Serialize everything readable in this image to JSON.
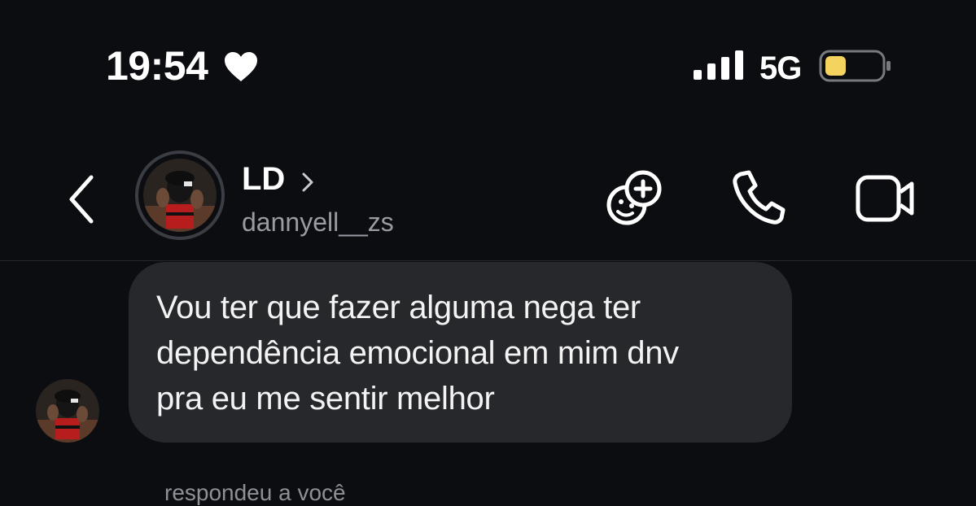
{
  "status_bar": {
    "time": "19:54",
    "network": "5G",
    "heart_icon": "heart-icon",
    "signal_icon": "cellular-signal-icon",
    "battery_icon": "battery-low-icon",
    "battery_color": "#f4d35e"
  },
  "header": {
    "contact_name": "LD",
    "username": "dannyell__zs",
    "icons": [
      "back-chevron-icon",
      "effects-icon",
      "phone-icon",
      "video-camera-icon"
    ]
  },
  "messages": [
    {
      "text": "Vou ter que fazer alguma nega ter\ndependência emocional em mim dnv\npra eu me sentir melhor"
    }
  ],
  "reply_note": "respondeu a você",
  "colors": {
    "background": "#0c0d10",
    "bubble": "#26282c",
    "secondary_text": "#9a9ca3"
  }
}
